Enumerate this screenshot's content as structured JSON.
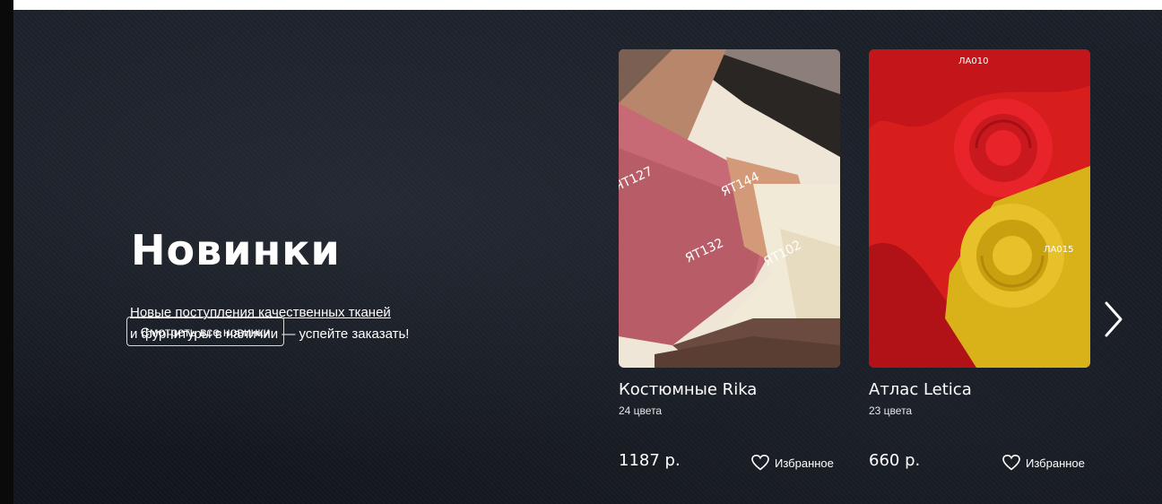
{
  "section": {
    "title": "Новинки",
    "subtitle_line1": "Новые поступления качественных тканей",
    "subtitle_line2": "и фурнитуры в наличии — успейте заказать!",
    "cta_label": "Смотреть все новинки"
  },
  "products": [
    {
      "name": "Костюмные Rika",
      "colors": "24 цвета",
      "price": "1187 р.",
      "favorite_label": "Избранное",
      "image_labels": [
        "ЯТ127",
        "ЯТ144",
        "ЯТ132",
        "ЯТ102"
      ]
    },
    {
      "name": "Атлас Letica",
      "colors": "23 цвета",
      "price": "660 р.",
      "favorite_label": "Избранное",
      "image_labels": [
        "ЛА010",
        "ЛА015"
      ]
    }
  ],
  "icons": {
    "favorite": "heart-outline-icon",
    "next": "chevron-right-icon"
  },
  "colors": {
    "background": "#161a22",
    "text": "#ffffff"
  }
}
